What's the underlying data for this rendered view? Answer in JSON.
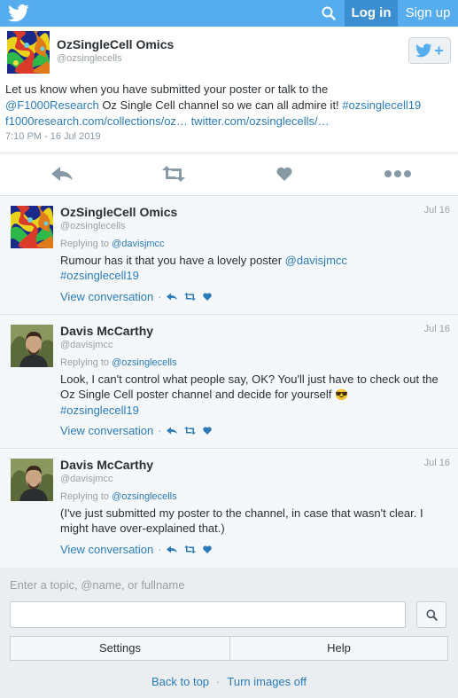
{
  "topbar": {
    "login": "Log in",
    "signup": "Sign up",
    "accent": "#55acee"
  },
  "tweet": {
    "author_name": "OzSingleCell Omics",
    "author_handle": "@ozsinglecells",
    "text_line1": "Let us know when you have submitted your poster or talk to the",
    "mention": "@F1000Research",
    "text_mid": " Oz Single Cell channel so we can all admire it! ",
    "hashtag": "#ozsinglecell19",
    "link1": "f1000research.com/collections/oz…",
    "link2": "twitter.com/ozsinglecells/…",
    "timestamp": "7:10 PM - 16 Jul 2019"
  },
  "replies": [
    {
      "name": "OzSingleCell Omics",
      "handle": "@ozsinglecells",
      "date": "Jul 16",
      "replying_prefix": "Replying to ",
      "replying_to": "@davisjmcc",
      "body_text": "Rumour has it that you have a lovely poster ",
      "body_mention": "@davisjmcc",
      "body_hashtag": "#ozsinglecell19",
      "view": "View conversation"
    },
    {
      "name": "Davis McCarthy",
      "handle": "@davisjmcc",
      "date": "Jul 16",
      "replying_prefix": "Replying to ",
      "replying_to": "@ozsinglecells",
      "body_text": "Look, I can't control what people say, OK? You'll just have to check out the Oz Single Cell poster channel and decide for yourself ",
      "emoji": "😎",
      "body_hashtag": "#ozsinglecell19",
      "view": "View conversation"
    },
    {
      "name": "Davis McCarthy",
      "handle": "@davisjmcc",
      "date": "Jul 16",
      "replying_prefix": "Replying to ",
      "replying_to": "@ozsinglecells",
      "body_text": "(I've just submitted my poster to the channel, in case that wasn't clear. I might have over-explained that.)",
      "view": "View conversation"
    }
  ],
  "search": {
    "placeholder": "Enter a topic, @name, or fullname",
    "value": ""
  },
  "buttons": {
    "settings": "Settings",
    "help": "Help"
  },
  "footer": {
    "back_to_top": "Back to top",
    "images_off": "Turn images off",
    "separator": "·"
  },
  "icons": {
    "bird": "twitter-bird-icon",
    "search": "search-icon",
    "follow": "follow-bird-plus-icon",
    "reply": "reply-icon",
    "retweet": "retweet-icon",
    "like": "heart-icon",
    "more": "more-icon"
  }
}
